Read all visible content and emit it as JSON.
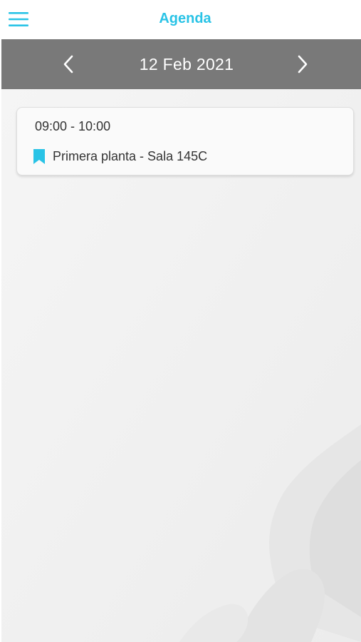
{
  "header": {
    "title": "Agenda",
    "menu_icon": "hamburger-menu-icon",
    "accent_color": "#29c3e6"
  },
  "date_nav": {
    "current_date": "12 Feb 2021",
    "prev_icon": "chevron-left-icon",
    "next_icon": "chevron-right-icon",
    "bar_color": "#797979"
  },
  "events": [
    {
      "time": "09:00 - 10:00",
      "location": "Primera planta - Sala 145C",
      "location_icon": "bookmark-icon"
    }
  ]
}
